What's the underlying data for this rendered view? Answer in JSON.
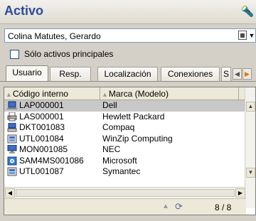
{
  "header": {
    "title": "Activo",
    "action_icon": "flashlight-icon"
  },
  "filter": {
    "selected_value": "Colina Matutes, Gerardo"
  },
  "options": {
    "principal_only_label": "Sólo activos principales",
    "principal_only_checked": false
  },
  "tabs": [
    {
      "label": "Usuario",
      "active": true
    },
    {
      "label": "Resp.",
      "active": false
    },
    {
      "label": "Localización",
      "active": false
    },
    {
      "label": "Conexiones",
      "active": false
    },
    {
      "label": "S",
      "active": false
    }
  ],
  "table": {
    "columns": [
      "Código interno",
      "Marca (Modelo)"
    ],
    "rows": [
      {
        "code": "LAP000001",
        "brand": "Dell",
        "icon": "laptop-icon",
        "selected": true
      },
      {
        "code": "LAS000001",
        "brand": "Hewlett Packard",
        "icon": "printer-icon",
        "selected": false
      },
      {
        "code": "DKT001083",
        "brand": "Compaq",
        "icon": "desktop-icon",
        "selected": false
      },
      {
        "code": "UTL001084",
        "brand": "WinZip Computing",
        "icon": "utility-software-icon",
        "selected": false
      },
      {
        "code": "MON001085",
        "brand": "NEC",
        "icon": "monitor-icon",
        "selected": false
      },
      {
        "code": "SAM4MS001086",
        "brand": "Microsoft",
        "icon": "software-icon",
        "selected": false
      },
      {
        "code": "UTL001087",
        "brand": "Symantec",
        "icon": "utility-software-icon",
        "selected": false
      }
    ]
  },
  "status": {
    "record_count": "8 / 8"
  },
  "colors": {
    "title": "#2a4a9c",
    "selected_row": "#c8c8c8",
    "panel_bg": "#d4d0c8"
  }
}
